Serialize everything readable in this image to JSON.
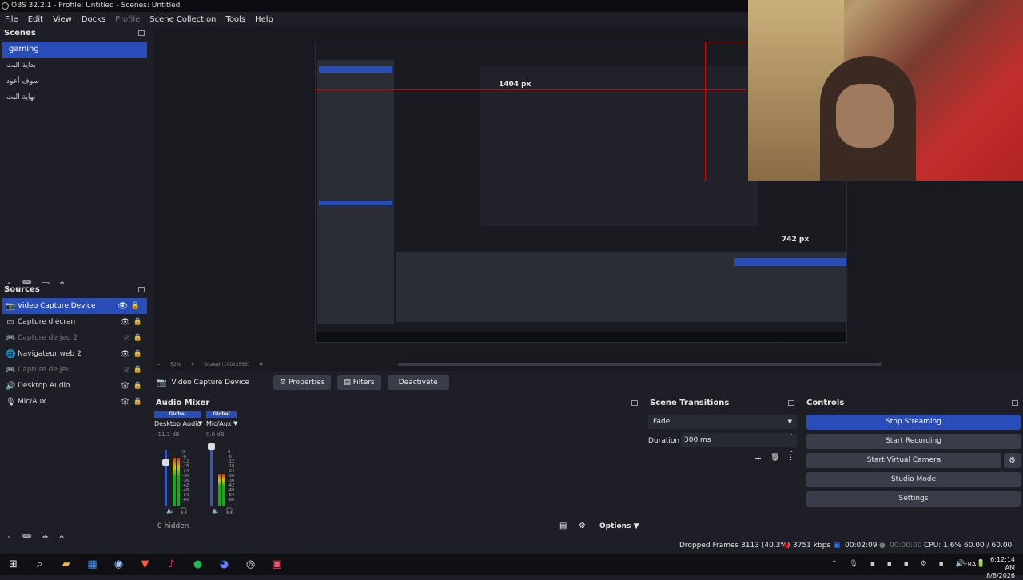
{
  "window": {
    "title": "OBS 32.2.1 - Profile: Untitled - Scenes: Untitled"
  },
  "menu": [
    "File",
    "Edit",
    "View",
    "Docks",
    "Profile",
    "Scene Collection",
    "Tools",
    "Help"
  ],
  "scenes": {
    "header": "Scenes",
    "items": [
      "gaming",
      "بداية البث",
      "سوف أعود",
      "نهاية البث"
    ]
  },
  "sources": {
    "header": "Sources",
    "items": [
      {
        "label": "Video Capture Device",
        "icon": "camera-icon"
      },
      {
        "label": "Capture d'écran",
        "icon": "monitor-icon"
      },
      {
        "label": "Capture de jeu 2",
        "icon": "gamepad-icon"
      },
      {
        "label": "Navigateur web 2",
        "icon": "globe-icon"
      },
      {
        "label": "Capture de jeu",
        "icon": "gamepad-icon"
      },
      {
        "label": "Desktop Audio",
        "icon": "speaker-icon"
      },
      {
        "label": "Mic/Aux",
        "icon": "mic-icon"
      }
    ]
  },
  "preview": {
    "px_label_top": "1404 px",
    "px_label_right": "742 px",
    "zoom": "52%",
    "scale_label": "Scaled (1002x563)"
  },
  "source_bar": {
    "name": "Video Capture Device",
    "properties": "Properties",
    "filters": "Filters",
    "deactivate": "Deactivate"
  },
  "mixer": {
    "header": "Audio Mixer",
    "channels": [
      {
        "badge": "Global",
        "name": "Desktop Audio",
        "db": "-11.2 dB",
        "level": 0.65
      },
      {
        "badge": "Global",
        "name": "Mic/Aux",
        "db": "0.0 dB",
        "level": 0.55
      }
    ],
    "scale": [
      "0",
      "-6",
      "-12",
      "-18",
      "-24",
      "-30",
      "-36",
      "-42",
      "-48",
      "-54",
      "-60"
    ],
    "hidden": "0 hidden",
    "options": "Options"
  },
  "transitions": {
    "header": "Scene Transitions",
    "selected": "Fade",
    "duration_label": "Duration",
    "duration_value": "300 ms"
  },
  "controls": {
    "header": "Controls",
    "stop_streaming": "Stop Streaming",
    "start_recording": "Start Recording",
    "start_virtual_camera": "Start Virtual Camera",
    "studio_mode": "Studio Mode",
    "settings": "Settings"
  },
  "status": {
    "dropped_frames": "Dropped Frames 3113 (40.3%)",
    "kbps": "3751 kbps",
    "stream_time": "00:02:09",
    "rec_time": "00:00:00",
    "cpu": "CPU: 1.6%",
    "fps": "60.00 / 60.00 FPS"
  },
  "taskbar": {
    "lang": "FRA",
    "time": "6:12:14 AM",
    "date": "8/8/2026"
  },
  "colors": {
    "accent": "#284cb8",
    "live": "#d10000"
  }
}
